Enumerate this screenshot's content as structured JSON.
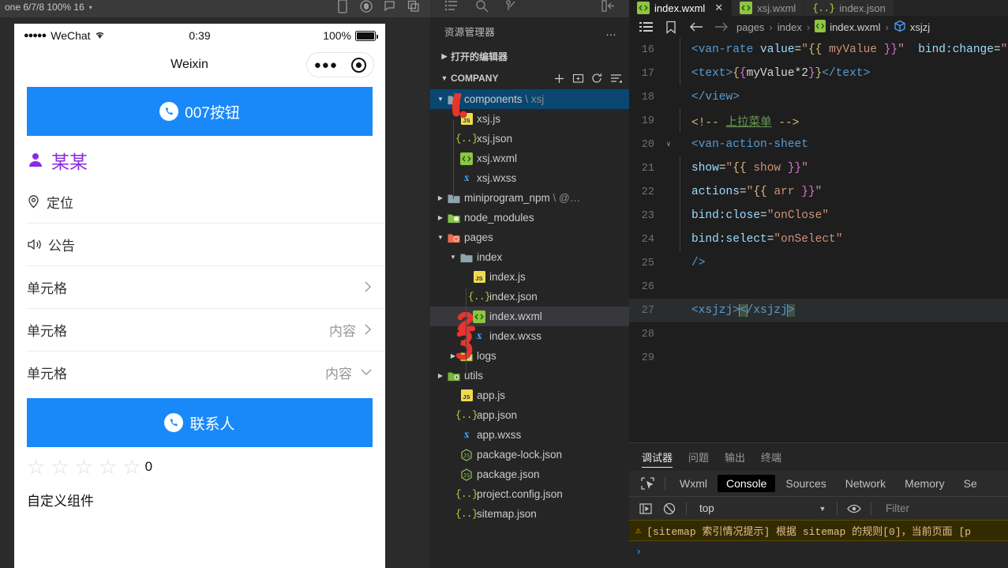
{
  "simulator": {
    "toolbar": {
      "device_label": "one 6/7/8 100% 16",
      "caret": "▾",
      "icons": [
        "phone-icon",
        "record-icon",
        "message-icon",
        "copy-icon"
      ]
    },
    "status_bar": {
      "signal_dots": "●●●●●",
      "carrier": "WeChat",
      "time": "0:39",
      "battery_percent": "100%"
    },
    "nav": {
      "title": "Weixin",
      "capsule_dots": "●●●"
    },
    "button_007": {
      "label": "007按钮"
    },
    "user_name": "某某",
    "cells": [
      {
        "title": "定位",
        "icon": "location-icon",
        "value": "",
        "arrow": ""
      },
      {
        "title": "公告",
        "icon": "volume-icon",
        "value": "",
        "arrow": ""
      },
      {
        "title": "单元格",
        "icon": "",
        "value": "",
        "arrow": "chevron-right"
      },
      {
        "title": "单元格",
        "icon": "",
        "value": "内容",
        "arrow": "chevron-right"
      },
      {
        "title": "单元格",
        "icon": "",
        "value": "内容",
        "arrow": "chevron-down"
      }
    ],
    "button_contact": {
      "label": "联系人"
    },
    "rate": {
      "stars": 5,
      "value": "0"
    },
    "custom_component_label": "自定义组件"
  },
  "explorer": {
    "activity_icons": [
      "explorer-icon",
      "search-icon",
      "source-control-icon",
      "panel-toggle-icon"
    ],
    "title": "资源管理器",
    "more": "…",
    "open_editors": {
      "label": "打开的编辑器",
      "expanded": false
    },
    "project": {
      "label": "COMPANY",
      "expanded": true,
      "actions": [
        "new-file-icon",
        "new-folder-icon",
        "refresh-icon",
        "collapse-all-icon"
      ]
    },
    "tree": [
      {
        "name": "components",
        "suffix": "\\ xsj",
        "type": "folder",
        "depth": 1,
        "expanded": true,
        "selected": true,
        "icon": "folder-icon",
        "annotation": "1"
      },
      {
        "name": "xsj.js",
        "type": "js",
        "depth": 2
      },
      {
        "name": "xsj.json",
        "type": "json",
        "depth": 2
      },
      {
        "name": "xsj.wxml",
        "type": "wxml",
        "depth": 2
      },
      {
        "name": "xsj.wxss",
        "type": "wxss",
        "depth": 2
      },
      {
        "name": "miniprogram_npm",
        "suffix": "\\ @…",
        "type": "folder",
        "depth": 1,
        "expanded": false,
        "icon": "folder-icon"
      },
      {
        "name": "node_modules",
        "type": "folder-npm",
        "depth": 1,
        "expanded": false
      },
      {
        "name": "pages",
        "type": "folder-pages",
        "depth": 1,
        "expanded": true
      },
      {
        "name": "index",
        "type": "folder",
        "depth": 2,
        "expanded": true
      },
      {
        "name": "index.js",
        "type": "js",
        "depth": 3
      },
      {
        "name": "index.json",
        "type": "json",
        "depth": 3,
        "annotation": "2"
      },
      {
        "name": "index.wxml",
        "type": "wxml",
        "depth": 3,
        "active": true,
        "annotation": "3"
      },
      {
        "name": "index.wxss",
        "type": "wxss",
        "depth": 3
      },
      {
        "name": "logs",
        "type": "folder-logs",
        "depth": 2,
        "expanded": false
      },
      {
        "name": "utils",
        "type": "folder-utils",
        "depth": 1,
        "expanded": false
      },
      {
        "name": "app.js",
        "type": "js",
        "depth": 2
      },
      {
        "name": "app.json",
        "type": "json",
        "depth": 2
      },
      {
        "name": "app.wxss",
        "type": "wxss",
        "depth": 2
      },
      {
        "name": "package-lock.json",
        "type": "npm",
        "depth": 2
      },
      {
        "name": "package.json",
        "type": "npm",
        "depth": 2
      },
      {
        "name": "project.config.json",
        "type": "json",
        "depth": 2
      },
      {
        "name": "sitemap.json",
        "type": "json",
        "depth": 2
      }
    ]
  },
  "editor": {
    "tabs": [
      {
        "label": "index.wxml",
        "icon": "wxml-icon",
        "active": true,
        "close": "✕"
      },
      {
        "label": "xsj.wxml",
        "icon": "wxml-icon",
        "active": false
      },
      {
        "label": "index.json",
        "icon": "json-icon",
        "active": false
      }
    ],
    "breadcrumb": [
      "pages",
      "index",
      "index.wxml",
      "xsjzj"
    ],
    "breadcrumb_sep": "›",
    "toolbar_icons": [
      "outline-icon",
      "bookmark-icon",
      "back-arrow-icon",
      "forward-arrow-icon"
    ],
    "lines": [
      {
        "n": "16",
        "indent": true,
        "fold": ""
      },
      {
        "n": "17",
        "indent": true,
        "fold": ""
      },
      {
        "n": "18",
        "indent": false,
        "fold": ""
      },
      {
        "n": "19",
        "indent": true,
        "fold": ""
      },
      {
        "n": "20",
        "indent": false,
        "fold": "∨"
      },
      {
        "n": "21",
        "indent": true,
        "fold": ""
      },
      {
        "n": "22",
        "indent": true,
        "fold": ""
      },
      {
        "n": "23",
        "indent": true,
        "fold": ""
      },
      {
        "n": "24",
        "indent": true,
        "fold": ""
      },
      {
        "n": "25",
        "indent": false,
        "fold": ""
      },
      {
        "n": "26",
        "indent": false,
        "fold": ""
      },
      {
        "n": "27",
        "indent": false,
        "fold": "",
        "highlight": true
      },
      {
        "n": "28",
        "indent": false,
        "fold": ""
      },
      {
        "n": "29",
        "indent": false,
        "fold": ""
      }
    ],
    "code_text": {
      "l16": "<van-rate value=\"{{ myValue }}\"  bind:change=\"",
      "l17": "<text>{{myValue*2}}</text>",
      "l18": "</view>",
      "l19": "<!-- 上拉菜单 -->",
      "l20": "<van-action-sheet",
      "l21": "show=\"{{ show }}\"",
      "l22": "actions=\"{{ arr }}\"",
      "l23": "bind:close=\"onClose\"",
      "l24": "bind:select=\"onSelect\"",
      "l25": "/>",
      "l27": "<xsjzj></xsjzj>"
    }
  },
  "devtools": {
    "tabs": [
      {
        "label": "调试器",
        "active": true
      },
      {
        "label": "问题",
        "active": false
      },
      {
        "label": "输出",
        "active": false
      },
      {
        "label": "终端",
        "active": false
      }
    ],
    "panels": [
      {
        "label": "Wxml",
        "active": false
      },
      {
        "label": "Console",
        "active": true
      },
      {
        "label": "Sources",
        "active": false
      },
      {
        "label": "Network",
        "active": false
      },
      {
        "label": "Memory",
        "active": false
      },
      {
        "label": "Se",
        "active": false
      }
    ],
    "console_bar": {
      "context": "top",
      "filter_placeholder": "Filter",
      "icons": [
        "sidebar-toggle-icon",
        "clear-console-icon",
        "eye-icon",
        "chevron-down-icon"
      ]
    },
    "message": "[sitemap 索引情况提示] 根据 sitemap 的规则[0]，当前页面 [p",
    "prompt": "›"
  },
  "colors": {
    "accent_blue": "#1989fa",
    "selected_blue": "#094771",
    "editor_bg": "#1e1e1e",
    "sidebar_bg": "#252526",
    "warn_bg": "#332b00",
    "annotation_red": "#e8352b",
    "purple_name": "#8a2be2"
  }
}
